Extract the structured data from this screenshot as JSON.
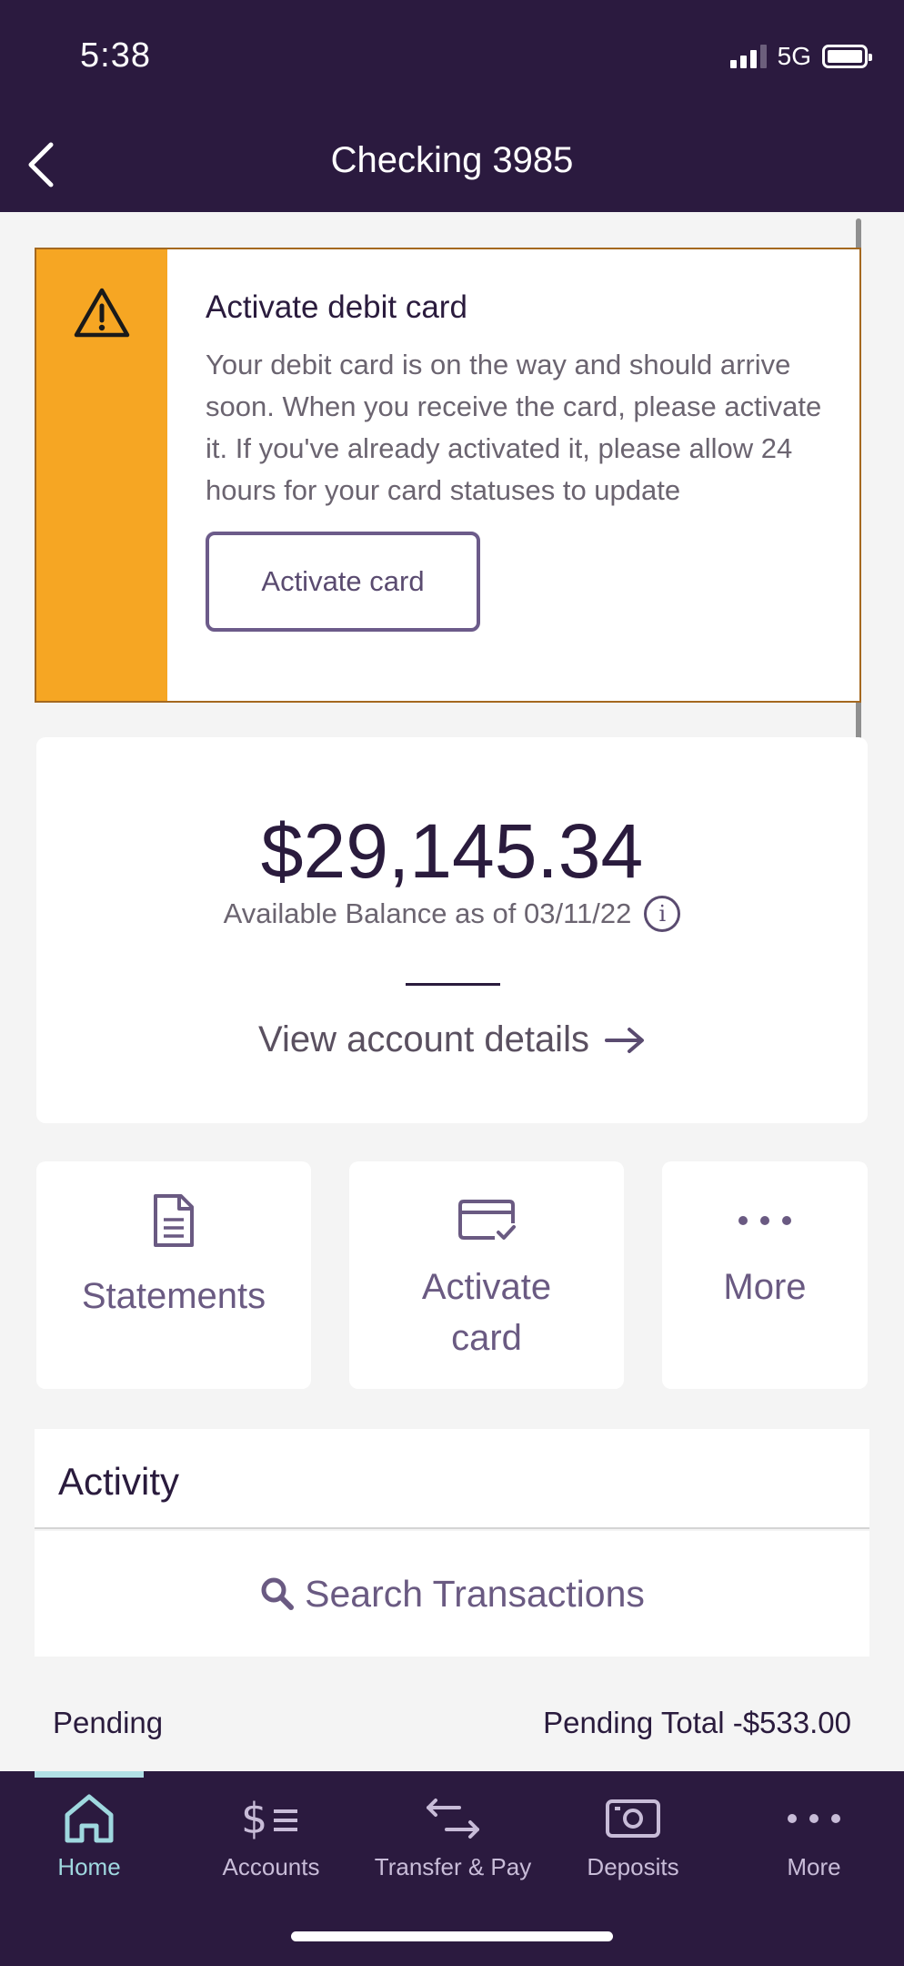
{
  "status_bar": {
    "time": "5:38",
    "network": "5G"
  },
  "nav": {
    "title": "Checking 3985",
    "back_icon": "chevron-left-icon"
  },
  "alert": {
    "icon": "warning-icon",
    "title": "Activate debit card",
    "message": "Your debit card is on the way and should arrive soon. When you receive the card, please activate it. If you've already activated it, please allow 24 hours for your card statuses to update",
    "button_label": "Activate card",
    "stripe_color": "#f6a623"
  },
  "balance": {
    "amount": "$29,145.34",
    "subtitle": "Available Balance as of 03/11/22",
    "info_icon": "info-icon",
    "view_details": "View account details",
    "arrow": "→"
  },
  "tiles": [
    {
      "label": "Statements",
      "icon": "document-icon"
    },
    {
      "label": "Activate card",
      "icon": "card-check-icon"
    },
    {
      "label": "More",
      "icon": "ellipsis-icon"
    }
  ],
  "activity": {
    "title": "Activity",
    "search_label": "Search Transactions",
    "pending_label": "Pending",
    "pending_total": "Pending Total -$533.00"
  },
  "tab_bar": {
    "active": "Home",
    "tabs": [
      {
        "label": "Home",
        "icon": "home-icon"
      },
      {
        "label": "Accounts",
        "icon": "dollar-list-icon"
      },
      {
        "label": "Transfer & Pay",
        "icon": "transfer-arrows-icon"
      },
      {
        "label": "Deposits",
        "icon": "camera-deposit-icon"
      },
      {
        "label": "More",
        "icon": "ellipsis-icon"
      }
    ]
  },
  "colors": {
    "header": "#2b1a3f",
    "accent": "#6a5a82",
    "warning": "#f6a623",
    "active_tab": "#9fd8df"
  }
}
